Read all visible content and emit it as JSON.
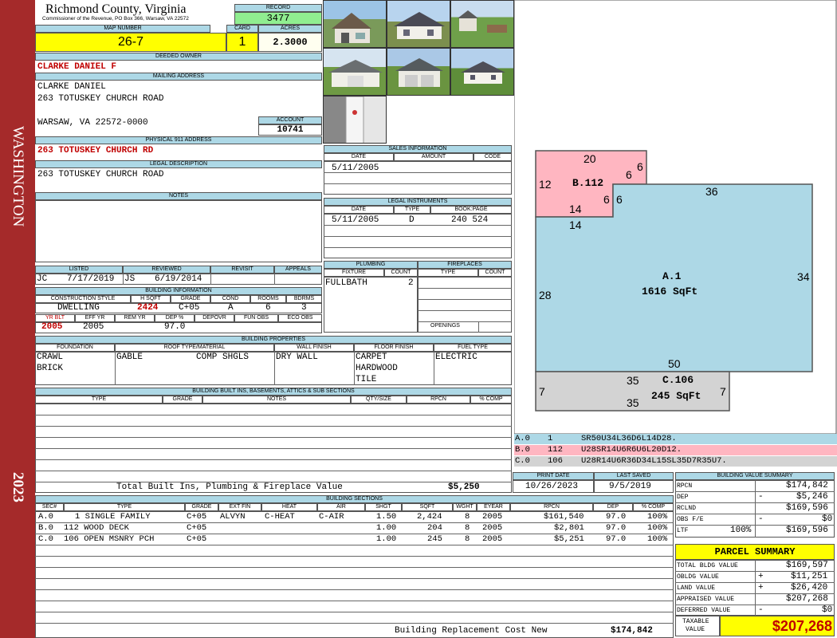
{
  "sidebar": {
    "owner_last": "WASHINGTON",
    "year": "2023"
  },
  "header": {
    "county": "Richmond County, Virginia",
    "address": "Commissioner of the Revenue, PO Box 366, Warsaw, VA 22572",
    "record_label": "RECORD",
    "record": "3477"
  },
  "parcel": {
    "map_label": "MAP NUMBER",
    "map_number": "26-7",
    "card_label": "CARD",
    "card": "1",
    "acres_label": "ACRES",
    "acres": "2.3000"
  },
  "owner": {
    "deeded_label": "DEEDED OWNER",
    "deeded": "CLARKE DANIEL F",
    "mailing_label": "MAILING ADDRESS",
    "mail1": "CLARKE DANIEL",
    "mail2": "263 TOTUSKEY CHURCH ROAD",
    "mail3": "WARSAW, VA 22572-0000",
    "account_label": "ACCOUNT",
    "account": "10741",
    "phys_label": "PHYSICAL 911 ADDRESS",
    "physical": "263 TOTUSKEY CHURCH RD",
    "legal_label": "LEGAL DESCRIPTION",
    "legal": "263 TOTUSKEY CHURCH ROAD",
    "notes_label": "NOTES"
  },
  "sales": {
    "title": "SALES INFORMATION",
    "headers": [
      "DATE",
      "AMOUNT",
      "CODE"
    ],
    "date": "5/11/2005"
  },
  "legal_instruments": {
    "title": "LEGAL INSTRUMENTS",
    "headers": [
      "DATE",
      "TYPE",
      "BOOK:PAGE"
    ],
    "date": "5/11/2005",
    "type": "D",
    "bookpage": "240 524"
  },
  "review": {
    "headers": [
      "LISTED",
      "REVIEWED",
      "REVISIT",
      "APPEALS"
    ],
    "listed_by": "JC",
    "listed_date": "7/17/2019",
    "reviewed_by": "JS",
    "reviewed_date": "6/19/2014"
  },
  "building_info": {
    "title": "BUILDING INFORMATION",
    "headers": [
      "CONSTRUCTION STYLE",
      "H SQFT",
      "GRADE",
      "COND",
      "ROOMS",
      "BDRMS"
    ],
    "style": "DWELLING",
    "hsqft": "2424",
    "grade": "C+05",
    "cond": "A",
    "rooms": "6",
    "bdrms": "3",
    "headers2": [
      "YR BLT",
      "EFF YR",
      "REM YR",
      "DEP %",
      "DEPOVR",
      "FUN OBS",
      "ECO OBS"
    ],
    "yrblt": "2005",
    "effyr": "2005",
    "dep": "97.0"
  },
  "plumbing": {
    "title": "PLUMBING",
    "headers": [
      "FIXTURE",
      "COUNT"
    ],
    "fixture": "FULLBATH",
    "count": "2"
  },
  "fireplaces": {
    "title": "FIREPLACES",
    "headers": [
      "TYPE",
      "COUNT"
    ],
    "openings_label": "OPENINGS"
  },
  "properties": {
    "title": "BUILDING PROPERTIES",
    "headers": [
      "FOUNDATION",
      "ROOF TYPE/MATERIAL",
      "WALL FINISH",
      "FLOOR FINISH",
      "FUEL TYPE"
    ],
    "foundation1": "CRAWL",
    "foundation2": "BRICK",
    "roof1": "GABLE",
    "roof2": "COMP SHGLS",
    "wall": "DRY WALL",
    "floor1": "CARPET",
    "floor2": "HARDWOOD",
    "floor3": "TILE",
    "fuel": "ELECTRIC"
  },
  "builtins": {
    "title": "BUILDING BUILT INS, BASEMENTS, ATTICS & SUB SECTIONS",
    "headers": [
      "TYPE",
      "GRADE",
      "NOTES",
      "QTY/SIZE",
      "RPCN",
      "% COMP"
    ],
    "total_label": "Total Built Ins, Plumbing & Fireplace Value",
    "total": "$5,250"
  },
  "dates": {
    "print_label": "PRINT DATE",
    "print": "10/26/2023",
    "saved_label": "LAST SAVED",
    "saved": "9/5/2019"
  },
  "sections": {
    "title": "BUILDING SECTIONS",
    "headers": [
      "SEC#",
      "TYPE",
      "GRADE",
      "EXT FIN",
      "HEAT",
      "AIR",
      "SHGT",
      "SQFT",
      "WGHT",
      "EYEAR",
      "RPCN",
      "DEP",
      "% COMP"
    ],
    "rows": [
      {
        "sec": "A.0",
        "type": "1 SINGLE FAMILY",
        "grade": "C+05",
        "ext": "ALVYN",
        "heat": "C-HEAT",
        "air": "C-AIR",
        "shgt": "1.50",
        "sqft": "2,424",
        "wght": "8",
        "eyear": "2005",
        "rpcn": "$161,540",
        "dep": "97.0",
        "comp": "100%"
      },
      {
        "sec": "B.0",
        "type": "112 WOOD DECK",
        "grade": "C+05",
        "ext": "",
        "heat": "",
        "air": "",
        "shgt": "1.00",
        "sqft": "204",
        "wght": "8",
        "eyear": "2005",
        "rpcn": "$2,801",
        "dep": "97.0",
        "comp": "100%"
      },
      {
        "sec": "C.0",
        "type": "106 OPEN MSNRY PCH",
        "grade": "C+05",
        "ext": "",
        "heat": "",
        "air": "",
        "shgt": "1.00",
        "sqft": "245",
        "wght": "8",
        "eyear": "2005",
        "rpcn": "$5,251",
        "dep": "97.0",
        "comp": "100%"
      }
    ],
    "replacement_label": "Building Replacement Cost New",
    "replacement": "$174,842"
  },
  "sketch": {
    "b_label": "B.112",
    "a_label": "A.1",
    "a_area": "1616 SqFt",
    "c_label": "C.106",
    "c_area": "245 SqFt",
    "dims": {
      "b_top": "20",
      "b_right1": "6",
      "b_left": "12",
      "b_inner1": "6",
      "b_inner2": "6",
      "b_right2": "6",
      "b_bottom": "14",
      "a_top": "36",
      "a_right": "34",
      "a_left": "28",
      "a_inner": "14",
      "a_bottom": "50",
      "c_top": "35",
      "c_left": "7",
      "c_right": "7",
      "c_bottom": "35"
    },
    "colors": {
      "a": "#add8e6",
      "b": "#ffb6c1",
      "c": "#d3d3d3"
    },
    "traverse": [
      {
        "sec": "A.0",
        "code": "1",
        "path": "SR50U34L36D6L14D28.",
        "color": "#add8e6"
      },
      {
        "sec": "B.0",
        "code": "112",
        "path": "U28SR14U6R6U6L20D12.",
        "color": "#ffb6c1"
      },
      {
        "sec": "C.0",
        "code": "106",
        "path": "U28R14U6R36D34L15SL35D7R35U7.",
        "color": "#d3d3d3"
      }
    ]
  },
  "value_summary": {
    "title": "BUILDING VALUE SUMMARY",
    "rpcn_label": "RPCN",
    "rpcn": "$174,842",
    "dep_label": "DEP",
    "dep_sign": "-",
    "dep": "$5,246",
    "rclnd_label": "RCLND",
    "rclnd": "$169,596",
    "obs_label": "OBS F/E",
    "obs_sign": "-",
    "obs": "$0",
    "ltr_label": "LTF",
    "ltr_pct": "100%",
    "ltr": "$169,596"
  },
  "parcel_summary": {
    "title": "PARCEL SUMMARY",
    "total_bldg_label": "TOTAL BLDG VALUE",
    "total_bldg": "$169,597",
    "obldg_label": "OBLDG VALUE",
    "obldg_sign": "+",
    "obldg": "$11,251",
    "land_label": "LAND VALUE",
    "land_sign": "+",
    "land": "$26,420",
    "appraised_label": "APPRAISED VALUE",
    "appraised": "$207,268",
    "deferred_label": "DEFERRED VALUE",
    "deferred_sign": "-",
    "deferred": "$0",
    "taxable_label1": "TAXABLE",
    "taxable_label2": "VALUE",
    "taxable": "$207,268"
  }
}
